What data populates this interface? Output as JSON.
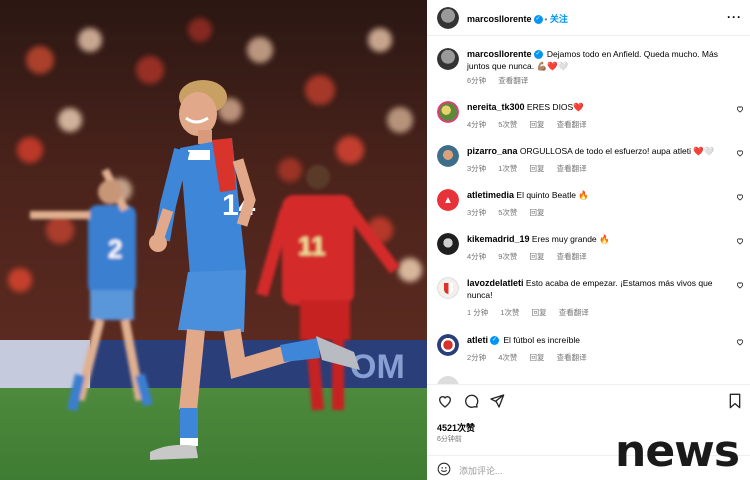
{
  "post": {
    "author": "marcosllorente",
    "follow_label": "关注",
    "caption": "Dejamos todo en Anfield. Queda mucho. Más juntos que nunca. 💪🏽❤️🤍",
    "caption_time": "6分钟",
    "translate_label": "查看翻译"
  },
  "comments": [
    {
      "user": "nereita_tk300",
      "text": "ERES DIOS❤️",
      "time": "4分钟",
      "likes": "5次赞",
      "reply": "回复",
      "translate": "查看翻译",
      "verified": false
    },
    {
      "user": "pizarro_ana",
      "text": "ORGULLOSA de todo el esfuerzo! aupa atleti ❤️🤍",
      "time": "3分钟",
      "likes": "1次赞",
      "reply": "回复",
      "translate": "查看翻译",
      "verified": false
    },
    {
      "user": "atletimedia",
      "text": "El quinto Beatle 🔥",
      "time": "3分钟",
      "likes": "5次赞",
      "reply": "回复",
      "translate": "",
      "verified": false
    },
    {
      "user": "kikemadrid_19",
      "text": "Eres muy grande 🔥",
      "time": "4分钟",
      "likes": "9次赞",
      "reply": "回复",
      "translate": "查看翻译",
      "verified": false
    },
    {
      "user": "lavozdelatleti",
      "text": "Esto acaba de empezar. ¡Estamos más vivos que nunca!",
      "time": "1 分钟",
      "likes": "1次赞",
      "reply": "回复",
      "translate": "查看翻译",
      "verified": false
    },
    {
      "user": "atleti",
      "text": "El fútbol es increíble",
      "time": "2分钟",
      "likes": "4次赞",
      "reply": "回复",
      "translate": "查看翻译",
      "verified": true
    }
  ],
  "stats": {
    "likes": "4521次赞",
    "time_ago": "6分钟前"
  },
  "add_comment_placeholder": "添加评论...",
  "watermark": "news",
  "colors": {
    "accent": "#0095f6",
    "heart": "#ed4956"
  }
}
